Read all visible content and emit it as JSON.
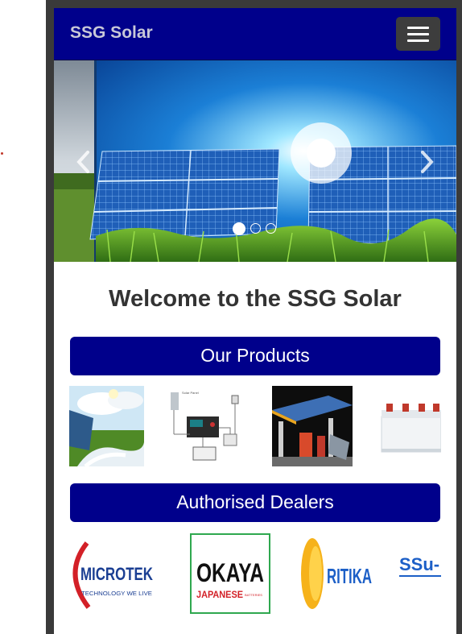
{
  "navbar": {
    "brand": "SSG Solar",
    "menu_icon": "hamburger-menu-icon"
  },
  "carousel": {
    "slides": [
      "solar panels field",
      "slide 2",
      "slide 3"
    ],
    "active_index": 0,
    "prev_icon": "chevron-left-icon",
    "next_icon": "chevron-right-icon"
  },
  "welcome": {
    "title": "Welcome to the SSG Solar"
  },
  "products": {
    "heading": "Our Products",
    "items": [
      "solar water pump",
      "solar charge controller diagram",
      "solar petrol station",
      "battery"
    ]
  },
  "dealers": {
    "heading": "Authorised Dealers",
    "logos": [
      {
        "name": "MICROTEK",
        "tagline": "TECHNOLOGY WE LIVE"
      },
      {
        "name": "OKAYA",
        "tagline": "JAPANESE"
      },
      {
        "name": "RITIKA",
        "tagline": ""
      },
      {
        "name": "SSu-",
        "tagline": ""
      }
    ]
  },
  "colors": {
    "brand_blue": "#00008b",
    "frame": "#3a3a3a",
    "toggle": "#3d3d3d"
  }
}
